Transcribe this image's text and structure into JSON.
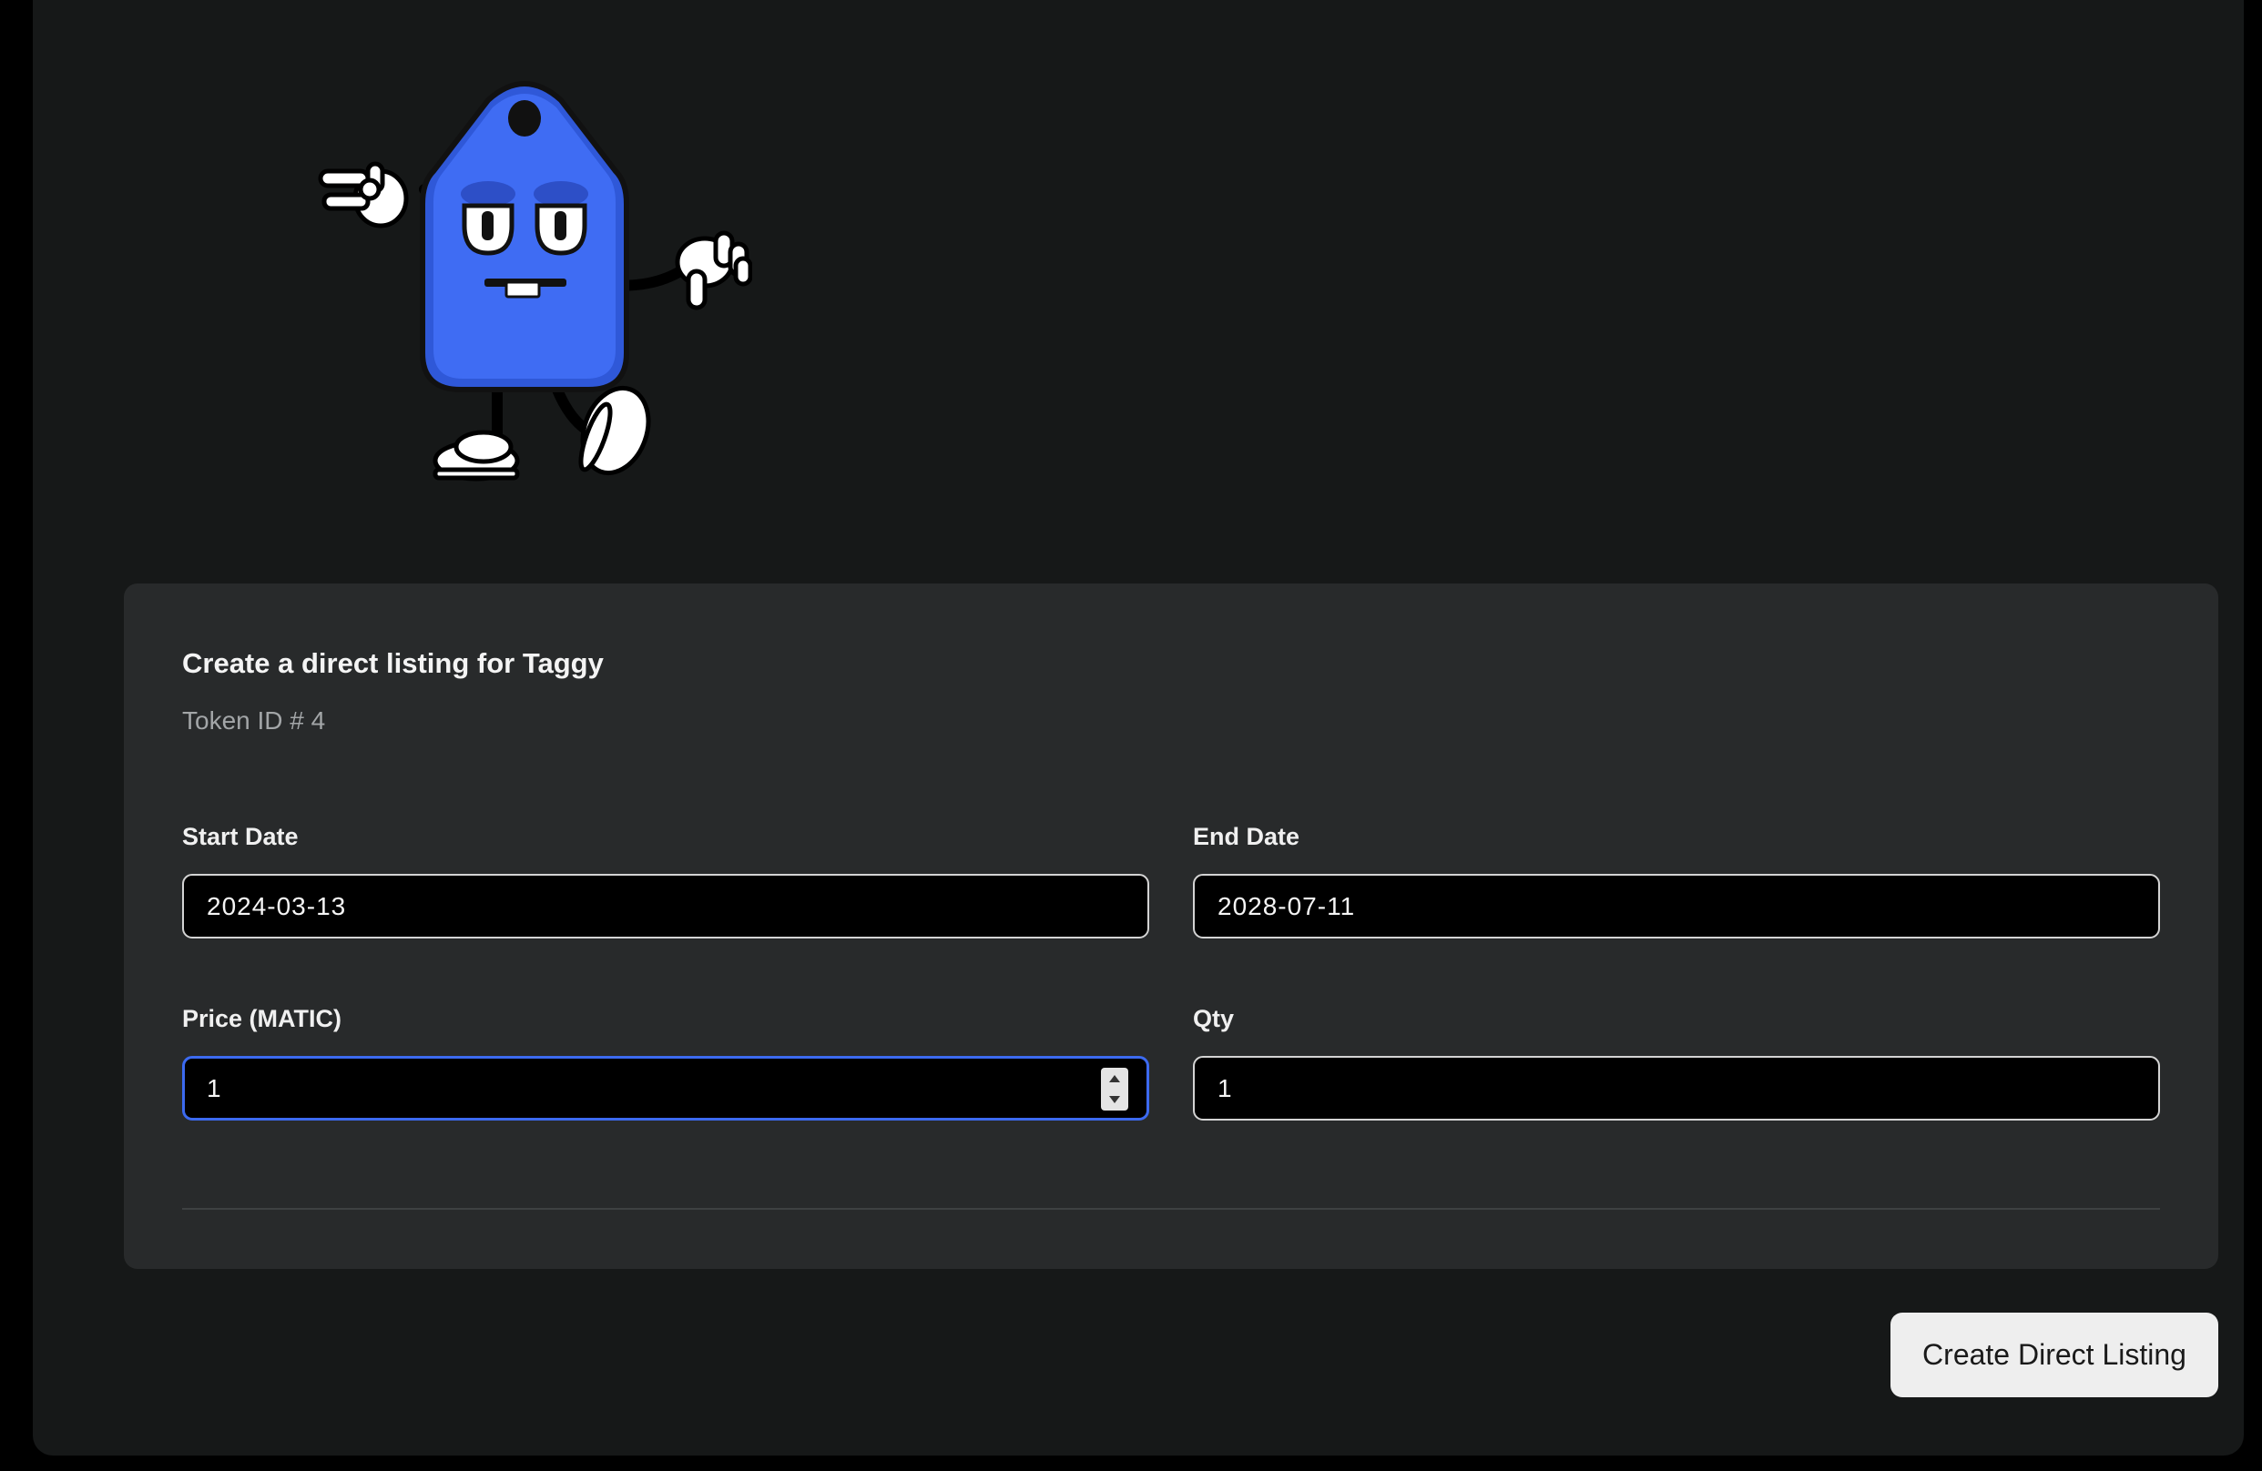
{
  "form": {
    "title": "Create a direct listing for Taggy",
    "subtitle": "Token ID # 4",
    "start_date": {
      "label": "Start Date",
      "value": "2024-03-13"
    },
    "end_date": {
      "label": "End Date",
      "value": "2028-07-11"
    },
    "price": {
      "label": "Price (MATIC)",
      "value": "1"
    },
    "qty": {
      "label": "Qty",
      "value": "1"
    }
  },
  "submit_label": "Create Direct Listing",
  "colors": {
    "background": "#161818",
    "card": "#282a2b",
    "input_background": "#000000",
    "focus_border": "#3c6af0",
    "mascot_blue": "#3f6cf3",
    "button": "#eeeeee"
  },
  "icons": {
    "mascot": "taggy-mascot-image",
    "stepper_up": "stepper-up-icon",
    "stepper_down": "stepper-down-icon"
  }
}
